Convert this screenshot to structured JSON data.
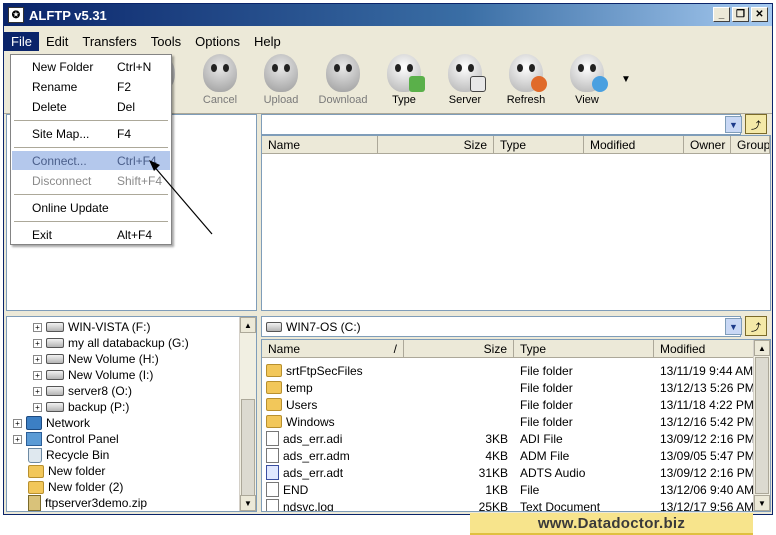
{
  "window": {
    "title": "ALFTP v5.31"
  },
  "menubar": [
    "File",
    "Edit",
    "Transfers",
    "Tools",
    "Options",
    "Help"
  ],
  "toolbar": {
    "buttons": [
      {
        "label": "nnect",
        "state": "disabled"
      },
      {
        "label": "Cancel",
        "state": "disabled"
      },
      {
        "label": "Upload",
        "state": "disabled"
      },
      {
        "label": "Download",
        "state": "disabled"
      },
      {
        "label": "Type",
        "state": "enabled"
      },
      {
        "label": "Server",
        "state": "enabled"
      },
      {
        "label": "Refresh",
        "state": "enabled"
      },
      {
        "label": "View",
        "state": "enabled"
      }
    ]
  },
  "file_menu": {
    "items": [
      {
        "label": "New Folder",
        "shortcut": "Ctrl+N",
        "state": "normal"
      },
      {
        "label": "Rename",
        "shortcut": "F2",
        "state": "normal"
      },
      {
        "label": "Delete",
        "shortcut": "Del",
        "state": "normal"
      },
      {
        "label": "Site Map...",
        "shortcut": "F4",
        "state": "normal"
      },
      {
        "label": "Connect...",
        "shortcut": "Ctrl+F4",
        "state": "highlighted"
      },
      {
        "label": "Disconnect",
        "shortcut": "Shift+F4",
        "state": "disabled"
      },
      {
        "label": "Online Update",
        "shortcut": "",
        "state": "normal"
      },
      {
        "label": "Exit",
        "shortcut": "Alt+F4",
        "state": "normal"
      }
    ]
  },
  "remote_pane": {
    "path": "",
    "columns": [
      "Name",
      "Size",
      "Type",
      "Modified",
      "Owner",
      "Group"
    ]
  },
  "local_tree": {
    "items": [
      {
        "label": "WIN-VISTA (F:)",
        "icon": "drive-icon"
      },
      {
        "label": "my all databackup (G:)",
        "icon": "drive-icon"
      },
      {
        "label": "New Volume (H:)",
        "icon": "drive-icon"
      },
      {
        "label": "New Volume (I:)",
        "icon": "drive-icon"
      },
      {
        "label": "server8 (O:)",
        "icon": "drive-icon"
      },
      {
        "label": "backup (P:)",
        "icon": "drive-icon"
      },
      {
        "label": "Network",
        "icon": "network-icon"
      },
      {
        "label": "Control Panel",
        "icon": "control-panel-icon"
      },
      {
        "label": "Recycle Bin",
        "icon": "recycle-bin-icon"
      },
      {
        "label": "New folder",
        "icon": "folder-icon"
      },
      {
        "label": "New folder (2)",
        "icon": "folder-icon"
      },
      {
        "label": "ftpserver3demo.zip",
        "icon": "zip-icon"
      }
    ]
  },
  "local_pane": {
    "path": "WIN7-OS (C:)",
    "columns": [
      "Name",
      "Size",
      "Type",
      "Modified"
    ],
    "sort_indicator": "/",
    "rows": [
      {
        "name": "srtFtpSecFiles",
        "size": "",
        "type": "File folder",
        "modified": "13/11/19 9:44 AM",
        "icon": "folder-icon"
      },
      {
        "name": "temp",
        "size": "",
        "type": "File folder",
        "modified": "13/12/13 5:26 PM",
        "icon": "folder-icon"
      },
      {
        "name": "Users",
        "size": "",
        "type": "File folder",
        "modified": "13/11/18 4:22 PM",
        "icon": "folder-icon"
      },
      {
        "name": "Windows",
        "size": "",
        "type": "File folder",
        "modified": "13/12/16 5:42 PM",
        "icon": "folder-icon"
      },
      {
        "name": "ads_err.adi",
        "size": "3KB",
        "type": "ADI File",
        "modified": "13/09/12 2:16 PM",
        "icon": "file-icon"
      },
      {
        "name": "ads_err.adm",
        "size": "4KB",
        "type": "ADM File",
        "modified": "13/09/05 5:47 PM",
        "icon": "file-icon"
      },
      {
        "name": "ads_err.adt",
        "size": "31KB",
        "type": "ADTS Audio",
        "modified": "13/09/12 2:16 PM",
        "icon": "audio-file-icon"
      },
      {
        "name": "END",
        "size": "1KB",
        "type": "File",
        "modified": "13/12/06 9:40 AM",
        "icon": "file-icon"
      },
      {
        "name": "ndsvc.log",
        "size": "25KB",
        "type": "Text Document",
        "modified": "13/12/17 9:56 AM",
        "icon": "file-icon"
      }
    ]
  },
  "banner": {
    "text": "www.Datadoctor.biz"
  },
  "colors": {
    "titlebar": "#0a246a",
    "menu_highlight": "#b4c8ec",
    "banner": "#f7e48c"
  }
}
